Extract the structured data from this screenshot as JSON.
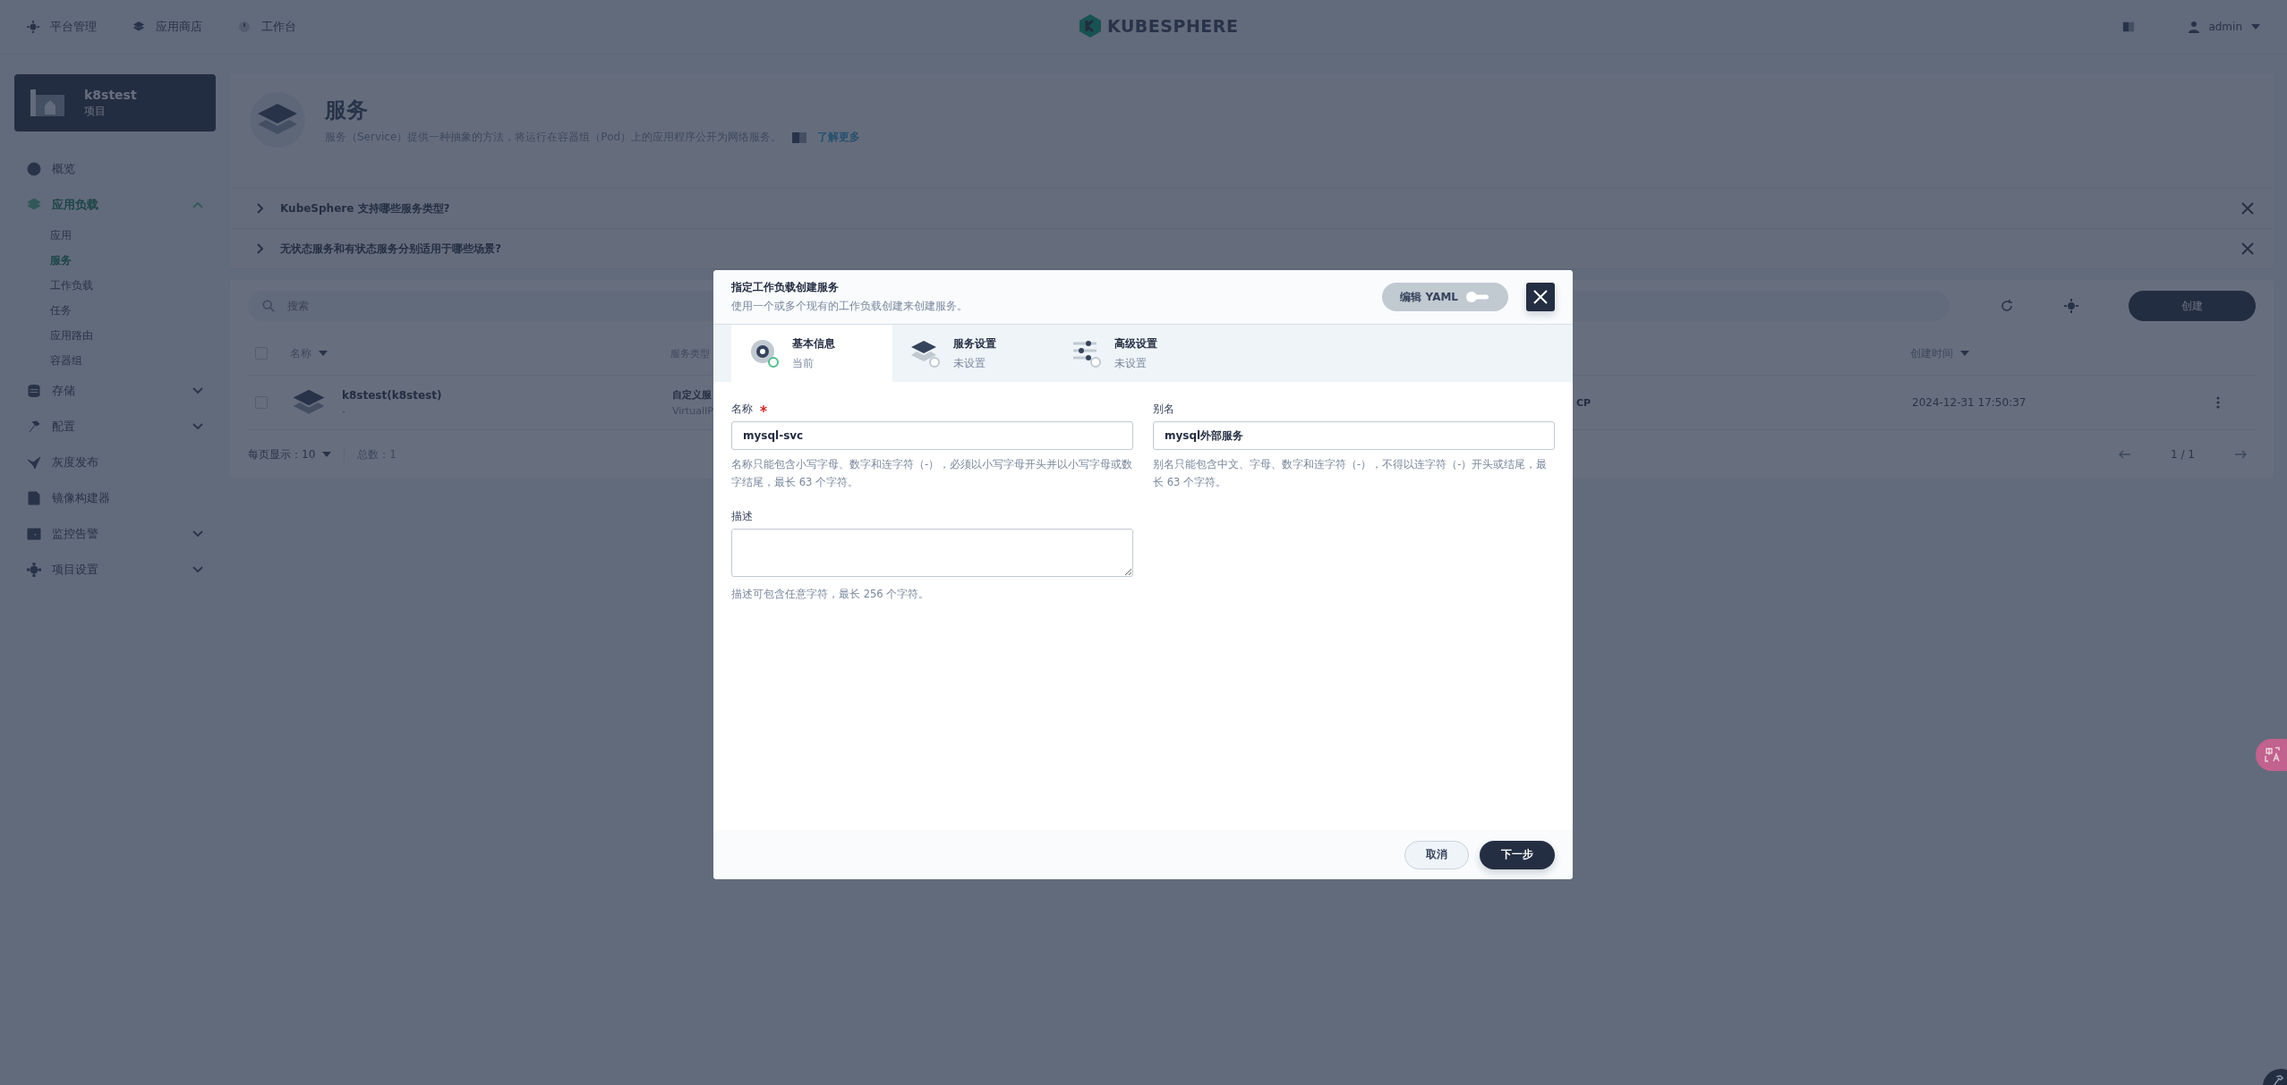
{
  "topbar": {
    "nav": [
      {
        "label": "平台管理"
      },
      {
        "label": "应用商店"
      },
      {
        "label": "工作台"
      }
    ],
    "logo": "KUBESPHERE",
    "user": "admin"
  },
  "sidebar": {
    "project": {
      "name": "k8stest",
      "type": "项目"
    },
    "items": [
      {
        "label": "概览",
        "selected": false
      },
      {
        "label": "应用负载",
        "selected": true,
        "expanded": true,
        "children": [
          {
            "label": "应用",
            "selected": false
          },
          {
            "label": "服务",
            "selected": true
          },
          {
            "label": "工作负载",
            "selected": false
          },
          {
            "label": "任务",
            "selected": false
          },
          {
            "label": "应用路由",
            "selected": false
          },
          {
            "label": "容器组",
            "selected": false
          }
        ]
      },
      {
        "label": "存储",
        "selected": false,
        "expanded": false
      },
      {
        "label": "配置",
        "selected": false,
        "expanded": false
      },
      {
        "label": "灰度发布",
        "selected": false
      },
      {
        "label": "镜像构建器",
        "selected": false
      },
      {
        "label": "监控告警",
        "selected": false,
        "expanded": false
      },
      {
        "label": "项目设置",
        "selected": false,
        "expanded": false
      }
    ]
  },
  "header": {
    "title": "服务",
    "description": "服务（Service）提供一种抽象的方法，将运行在容器组（Pod）上的应用程序公开为网络服务。",
    "link": "了解更多"
  },
  "faq": [
    {
      "question": "KubeSphere 支持哪些服务类型?"
    },
    {
      "question": "无状态服务和有状态服务分别适用于哪些场景?"
    }
  ],
  "table": {
    "search": {
      "placeholder": "搜索"
    },
    "create": "创建",
    "select_all": {
      "checked": false
    },
    "columns": [
      {
        "label": "名称"
      },
      {
        "label": "服务类型"
      },
      {
        "label": "创建时间"
      }
    ],
    "rows": [
      {
        "checked": false,
        "name": "k8stest(k8stest)",
        "sub": "-",
        "type": "自定义服",
        "type_sub": "VirtualIP",
        "column_4": "CP",
        "created": "2024-12-31 17:50:37"
      }
    ],
    "pagination": {
      "per_page": "每页显示：10",
      "total": "总数：1",
      "page": "1 / 1"
    }
  },
  "modal": {
    "title": "指定工作负载创建服务",
    "subtitle": "使用一个或多个现有的工作负载创建来创建服务。",
    "yaml": {
      "label": "编辑 YAML",
      "on": false
    },
    "steps": [
      {
        "title": "基本信息",
        "status": "当前",
        "selected": true
      },
      {
        "title": "服务设置",
        "status": "未设置",
        "selected": false
      },
      {
        "title": "高级设置",
        "status": "未设置",
        "selected": false
      }
    ],
    "name": {
      "label": "名称",
      "required": true,
      "value": "mysql-svc",
      "hint": "名称只能包含小写字母、数字和连字符（-），必须以小写字母开头并以小写字母或数字结尾，最长 63 个字符。"
    },
    "alias": {
      "label": "别名",
      "value": "mysql外部服务",
      "hint": "别名只能包含中文、字母、数字和连字符（-），不得以连字符（-）开头或结尾，最长 63 个字符。"
    },
    "description": {
      "label": "描述",
      "hint": "描述可包含任意字符，最长 256 个字符。"
    },
    "cancel": "取消",
    "next": "下一步"
  }
}
